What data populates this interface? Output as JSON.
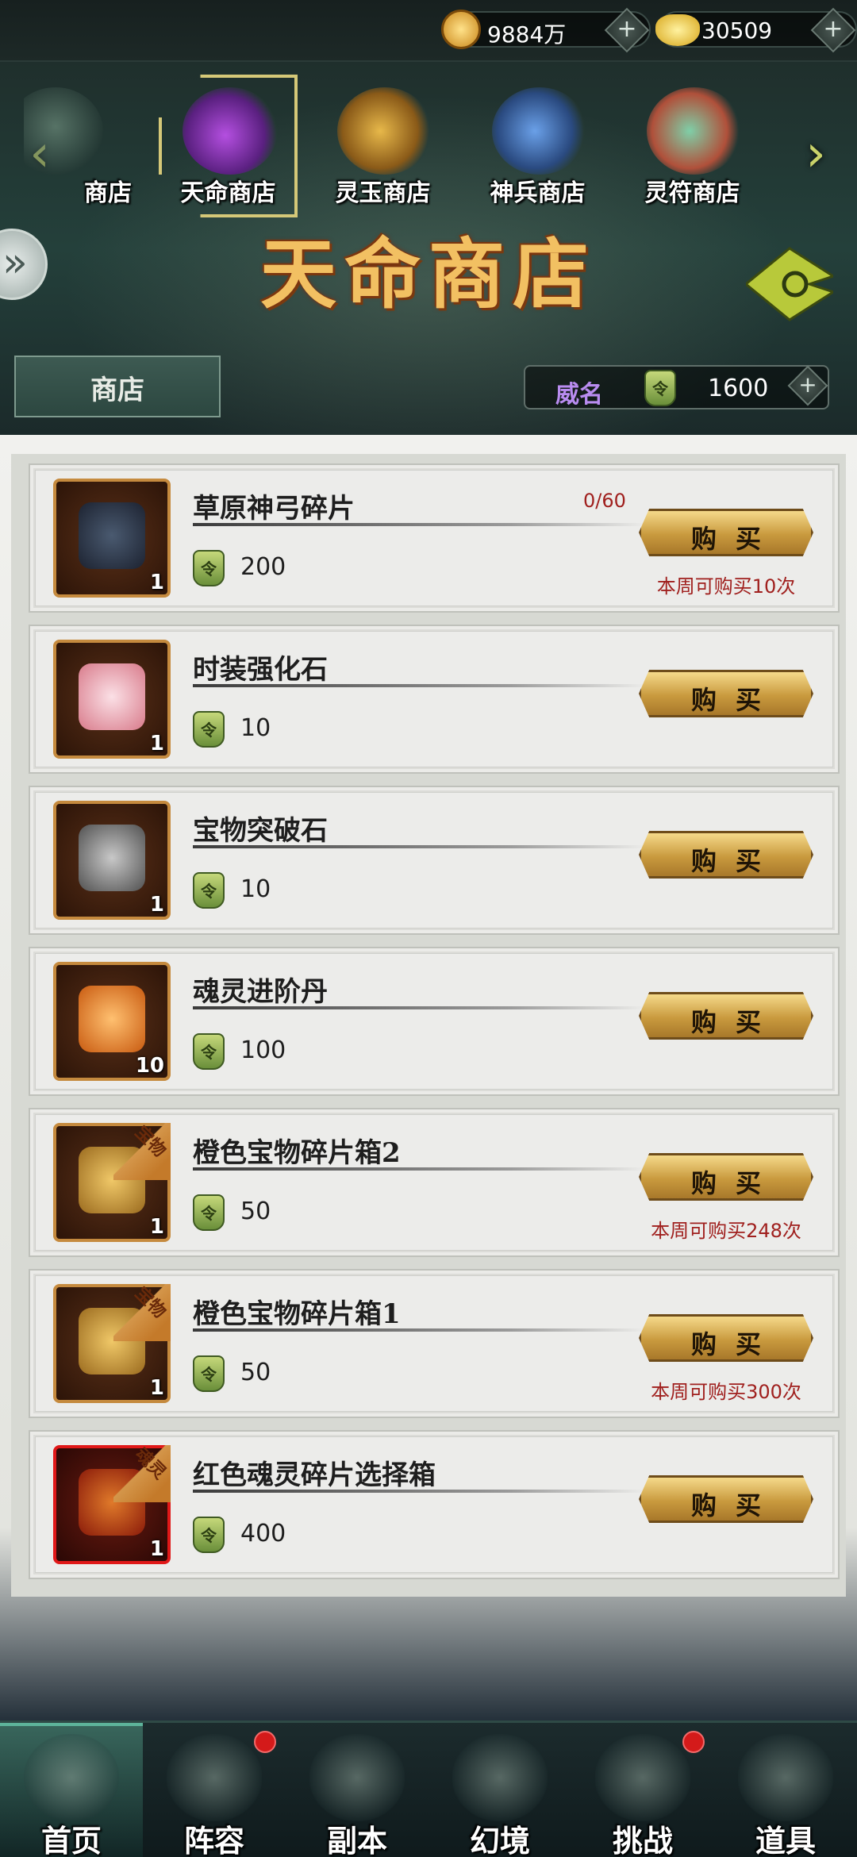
{
  "currencies": [
    {
      "icon": "coin-icon",
      "value": "9884万"
    },
    {
      "icon": "gold-ingot-icon",
      "value": "30509"
    }
  ],
  "shop_tabs": [
    {
      "label": "商店",
      "selected": false
    },
    {
      "label": "天命商店",
      "selected": true
    },
    {
      "label": "灵玉商店",
      "selected": false
    },
    {
      "label": "神兵商店",
      "selected": false
    },
    {
      "label": "灵符商店",
      "selected": false
    }
  ],
  "shop_title": "天命商店",
  "shop_label": "商店",
  "fame": {
    "label": "威名",
    "value": "1600"
  },
  "token_glyph": "令",
  "buy_label": "购买",
  "items": [
    {
      "name": "草原神弓碎片",
      "qty": "1",
      "price": "200",
      "owned": "0/60",
      "limit": "本周可购买10次",
      "ribbon": "",
      "red": false
    },
    {
      "name": "时装强化石",
      "qty": "1",
      "price": "10",
      "owned": "",
      "limit": "",
      "ribbon": "",
      "red": false
    },
    {
      "name": "宝物突破石",
      "qty": "1",
      "price": "10",
      "owned": "",
      "limit": "",
      "ribbon": "",
      "red": false
    },
    {
      "name": "魂灵进阶丹",
      "qty": "10",
      "price": "100",
      "owned": "",
      "limit": "",
      "ribbon": "",
      "red": false
    },
    {
      "name": "橙色宝物碎片箱2",
      "qty": "1",
      "price": "50",
      "owned": "",
      "limit": "本周可购买248次",
      "ribbon": "宝物",
      "red": false
    },
    {
      "name": "橙色宝物碎片箱1",
      "qty": "1",
      "price": "50",
      "owned": "",
      "limit": "本周可购买300次",
      "ribbon": "宝物",
      "red": false
    },
    {
      "name": "红色魂灵碎片选择箱",
      "qty": "1",
      "price": "400",
      "owned": "",
      "limit": "",
      "ribbon": "魂灵",
      "red": true
    }
  ],
  "nav": [
    {
      "label": "首页",
      "active": true,
      "badge": false
    },
    {
      "label": "阵容",
      "active": false,
      "badge": true
    },
    {
      "label": "副本",
      "active": false,
      "badge": false
    },
    {
      "label": "幻境",
      "active": false,
      "badge": false
    },
    {
      "label": "挑战",
      "active": false,
      "badge": true
    },
    {
      "label": "道具",
      "active": false,
      "badge": false
    }
  ],
  "colors": {
    "accent_gold": "#c99a3e",
    "limit_red": "#a0201e",
    "fame_purple": "#b98cf0"
  }
}
